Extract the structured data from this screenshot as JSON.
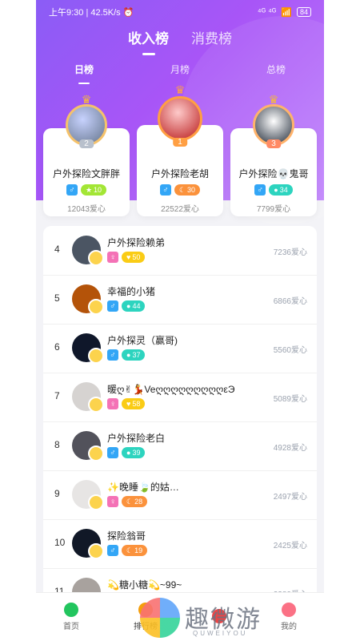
{
  "status": {
    "time": "上午9:30 | 42.5K/s ⏰",
    "network": "⁴ᴳ ⁴ᴳ ",
    "battery": "84"
  },
  "tabs_top": [
    {
      "label": "收入榜",
      "active": true
    },
    {
      "label": "消费榜",
      "active": false
    }
  ],
  "tabs_sub": [
    {
      "label": "日榜",
      "active": true
    },
    {
      "label": "月榜",
      "active": false
    },
    {
      "label": "总榜",
      "active": false
    }
  ],
  "podium": [
    {
      "rank_label": "2",
      "name": "户外探险文胖胖",
      "gender": "♂",
      "level": "10",
      "level_color": "#a3e635",
      "hearts": "12043爱心"
    },
    {
      "rank_label": "1",
      "name": "户外探险老胡",
      "gender": "♂",
      "level": "30",
      "level_color": "#fb923c",
      "hearts": "22522爱心"
    },
    {
      "rank_label": "3",
      "name": "户外探险💀鬼哥",
      "gender": "♂",
      "level": "34",
      "level_color": "#2dd4bf",
      "hearts": "7799爱心"
    }
  ],
  "list": [
    {
      "rank": "4",
      "name": "户外探险赖弟",
      "gender": "♀",
      "level": "50",
      "level_color": "#facc15",
      "hearts": "7236爱心"
    },
    {
      "rank": "5",
      "name": "幸福的小猪",
      "gender": "♂",
      "level": "44",
      "level_color": "#2dd4bf",
      "hearts": "6866爱心"
    },
    {
      "rank": "6",
      "name": "户外探灵（赢哥)",
      "gender": "♂",
      "level": "37",
      "level_color": "#2dd4bf",
      "hearts": "5560爱心"
    },
    {
      "rank": "7",
      "name": "暖ღ✌💃VeღღღღღღღღღԑЭ",
      "gender": "♀",
      "level": "58",
      "level_color": "#facc15",
      "hearts": "5089爱心"
    },
    {
      "rank": "8",
      "name": "户外探险老白",
      "gender": "♂",
      "level": "39",
      "level_color": "#2dd4bf",
      "hearts": "4928爱心"
    },
    {
      "rank": "9",
      "name": "✨晚睡🍃的姑…",
      "gender": "♀",
      "level": "28",
      "level_color": "#fb923c",
      "hearts": "2497爱心"
    },
    {
      "rank": "10",
      "name": "探险翁哥",
      "gender": "♂",
      "level": "19",
      "level_color": "#fb923c",
      "hearts": "2425爱心"
    },
    {
      "rank": "11",
      "name": "💫糖小糖💫~99~",
      "gender": "♀",
      "level": "",
      "level_color": "#fb923c",
      "hearts": "2380爱心"
    }
  ],
  "tabbar": [
    {
      "label": "首页",
      "icon": "home-icon",
      "active": false
    },
    {
      "label": "排行榜",
      "icon": "ranking-icon",
      "active": true
    },
    {
      "label": "",
      "icon": "center-icon",
      "active": false
    },
    {
      "label": "我的",
      "icon": "profile-icon",
      "active": false
    }
  ],
  "watermark": {
    "text": "趣微游",
    "sub": "QUWEIYOU"
  },
  "colors": {
    "accent": "#a855f7",
    "male": "#33a6f6",
    "female": "#f472b6"
  }
}
